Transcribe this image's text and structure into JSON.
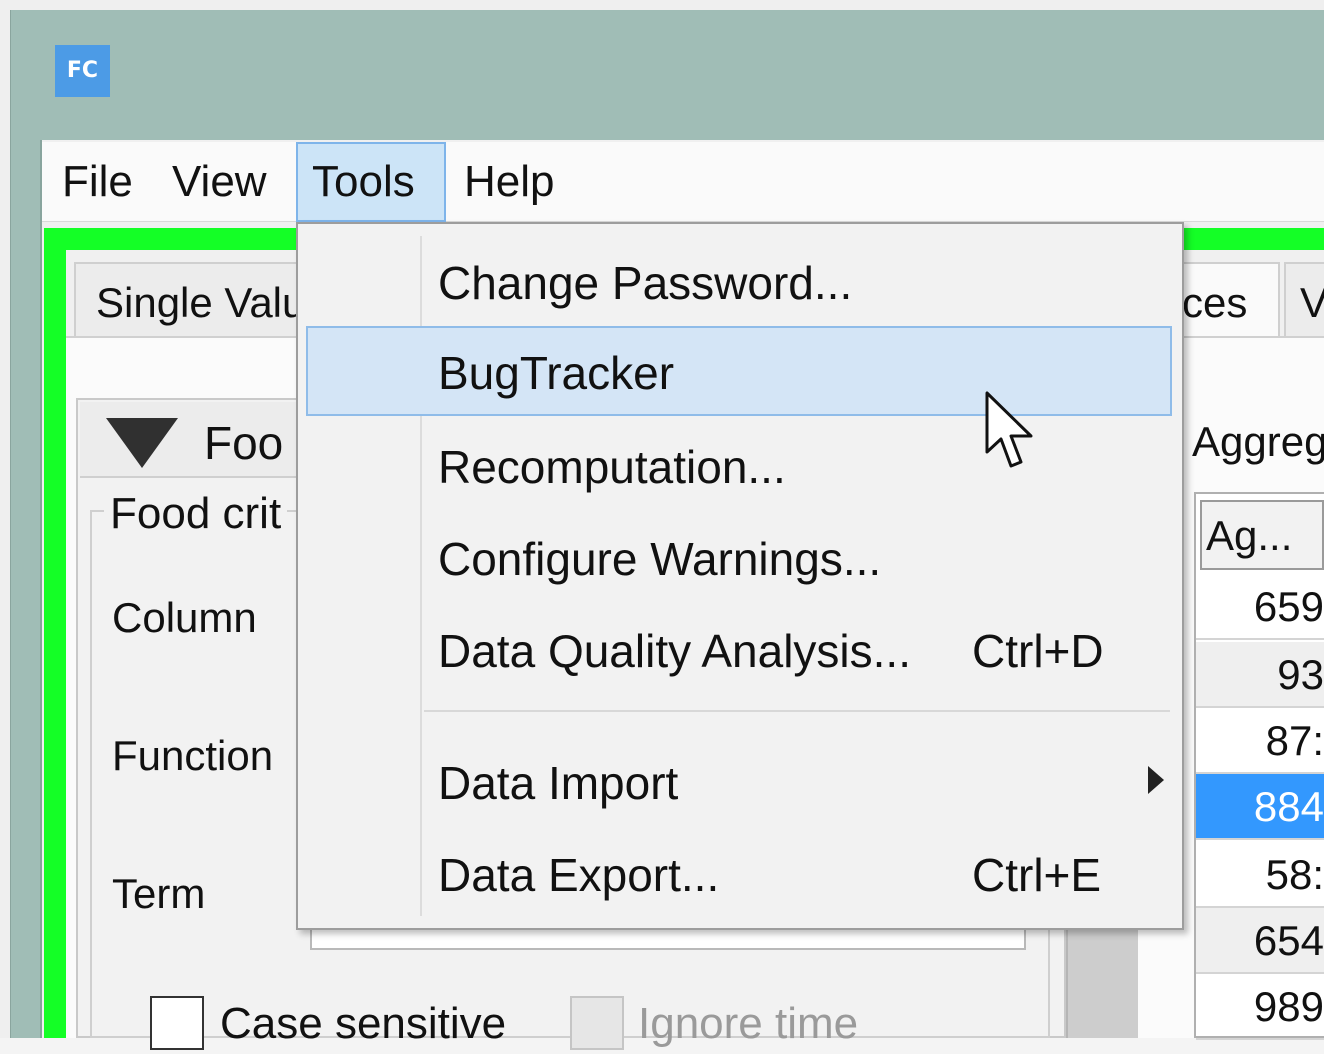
{
  "window": {
    "app_icon_text": "FC"
  },
  "menubar": {
    "items": [
      {
        "label": "File"
      },
      {
        "label": "View"
      },
      {
        "label": "Tools"
      },
      {
        "label": "Help"
      }
    ]
  },
  "tabs": [
    {
      "label": "Single Valu"
    },
    {
      "label": "ces"
    },
    {
      "label": "V"
    }
  ],
  "panel": {
    "header": "Foo",
    "group_title": "Food crit",
    "labels": {
      "column": "Column",
      "function": "Function",
      "term": "Term"
    },
    "checkboxes": {
      "case_sensitive": "Case sensitive",
      "ignore_time": "Ignore time"
    }
  },
  "results": {
    "label": "Aggreg",
    "column_header": "Ag...",
    "rows": [
      "659",
      "93",
      "87:",
      "884",
      "58:",
      "654",
      "989"
    ],
    "selected_index": 3
  },
  "tools_menu": {
    "items": [
      {
        "label": "Change Password...",
        "shortcut": ""
      },
      {
        "label": "BugTracker",
        "shortcut": ""
      },
      {
        "label": "Recomputation...",
        "shortcut": ""
      },
      {
        "label": "Configure Warnings...",
        "shortcut": ""
      },
      {
        "label": "Data Quality Analysis...",
        "shortcut": "Ctrl+D"
      },
      {
        "label": "Data Import",
        "shortcut": ""
      },
      {
        "label": "Data Export...",
        "shortcut": "Ctrl+E"
      }
    ],
    "hovered_index": 1
  },
  "colors": {
    "window_frame": "#a0bdb6",
    "app_icon": "#4c9be6",
    "green_border": "#14ff26",
    "selection": "#3398fe",
    "menu_highlight": "#cce4f7"
  }
}
